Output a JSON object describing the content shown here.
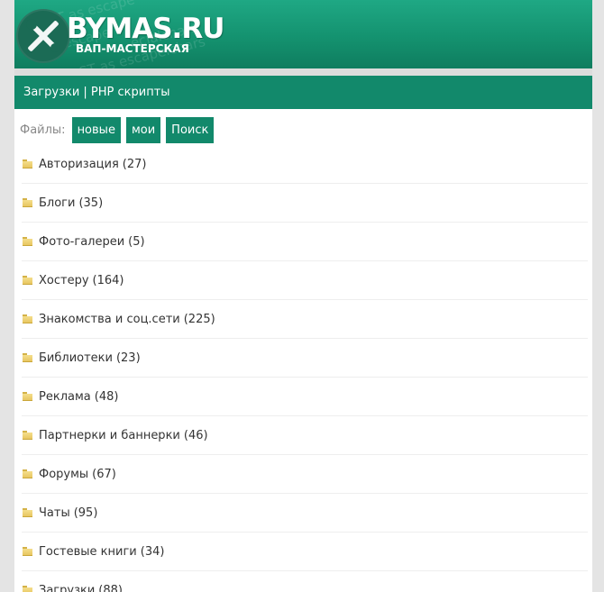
{
  "header": {
    "logo_title": "BYMAS.RU",
    "logo_subtitle": "ВАП-МАСТЕРСКАЯ"
  },
  "section": {
    "title": "Загрузки | PHP скрипты"
  },
  "files": {
    "label": "Файлы:",
    "buttons": [
      "новые",
      "мои",
      "Поиск"
    ]
  },
  "categories": [
    {
      "label": "Авторизация",
      "count": "(27)"
    },
    {
      "label": "Блоги",
      "count": "(35)"
    },
    {
      "label": "Фото-галереи",
      "count": "(5)"
    },
    {
      "label": "Хостеру",
      "count": "(164)"
    },
    {
      "label": "Знакомства и соц.сети",
      "count": "(225)"
    },
    {
      "label": "Библиотеки",
      "count": "(23)"
    },
    {
      "label": "Реклама",
      "count": "(48)"
    },
    {
      "label": "Партнерки и баннерки",
      "count": "(46)"
    },
    {
      "label": "Форумы",
      "count": "(67)"
    },
    {
      "label": "Чаты",
      "count": "(95)"
    },
    {
      "label": "Гостевые книги",
      "count": "(34)"
    },
    {
      "label": "Загрузки",
      "count": "(88)"
    }
  ],
  "colors": {
    "accent": "#12896b",
    "banner_top": "#1fa884",
    "folder": "#e8c661"
  },
  "icons": {
    "logo": "wrench-screwdriver-icon",
    "category": "folder-icon"
  }
}
